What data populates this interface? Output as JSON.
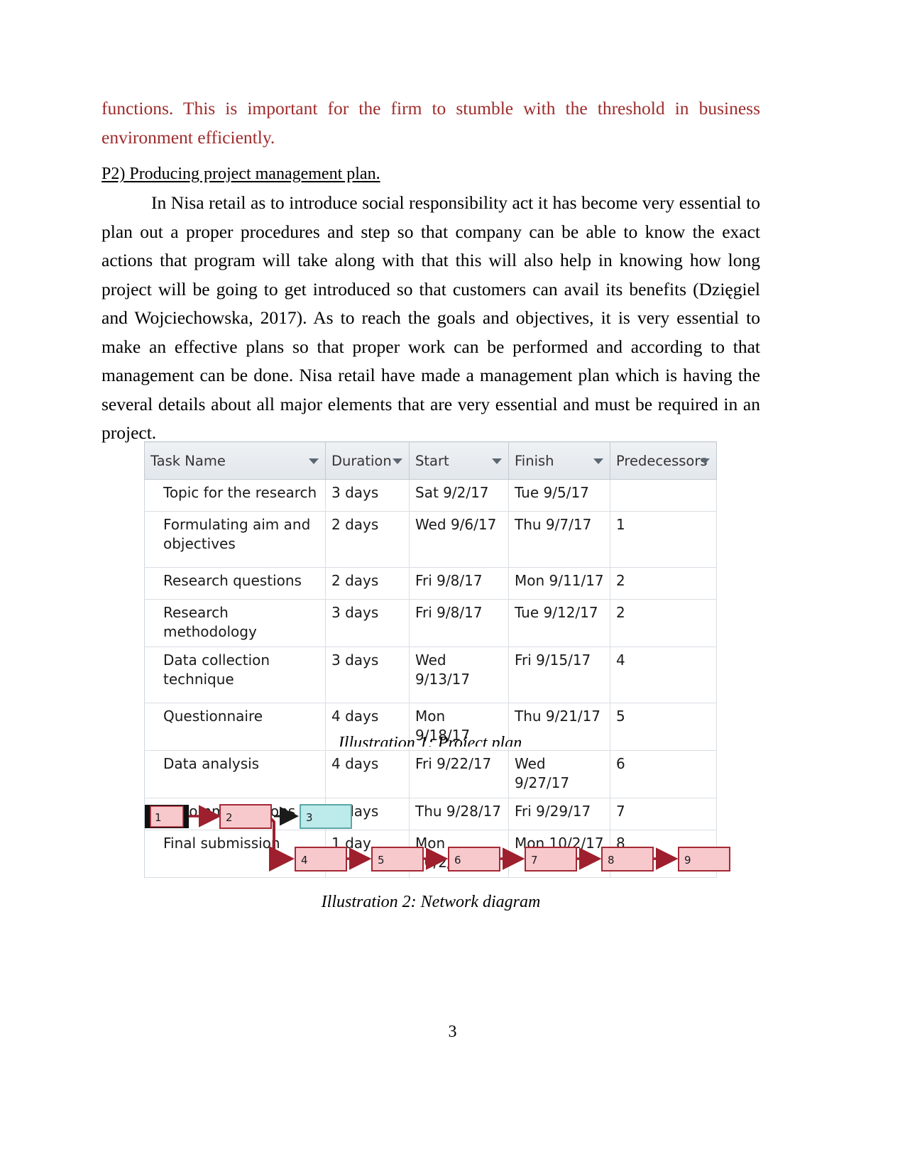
{
  "document": {
    "page_number": "3",
    "accent_red": "#9e2b2b",
    "paragraph_red": "functions. This is important for the firm to stumble with the threshold in business environment efficiently.",
    "heading": "P2) Producing project management plan.",
    "paragraph_body": "In Nisa retail as to introduce social responsibility act it has become very essential to plan out a proper procedures and step so that company can be able to know the exact actions that program will take along with that this will also help in knowing how long project will be going to get introduced so that customers can avail its benefits  (Dzięgiel and Wojciechowska, 2017). As to reach the goals and objectives, it is very essential to make an effective plans so that proper work can be performed and according to that management can be done. Nisa retail have made a management plan which is having the several details about all major elements that are very essential and must be required in an project."
  },
  "project_table": {
    "caption": "Illustration 1: Project plan",
    "columns": [
      {
        "label": "Task Name",
        "icon": "filter-dropdown-icon"
      },
      {
        "label": "Duration",
        "icon": "filter-dropdown-icon"
      },
      {
        "label": "Start",
        "icon": "filter-dropdown-icon"
      },
      {
        "label": "Finish",
        "icon": "filter-dropdown-icon"
      },
      {
        "label": "Predecessors",
        "icon": "filter-dropdown-icon"
      }
    ],
    "rows": [
      {
        "task": "Topic for the research",
        "duration": "3 days",
        "start": "Sat 9/2/17",
        "finish": "Tue 9/5/17",
        "predecessors": "",
        "tall": false,
        "selected": false
      },
      {
        "task": "Formulating aim and objectives",
        "duration": "2 days",
        "start": "Wed 9/6/17",
        "finish": "Thu 9/7/17",
        "predecessors": "1",
        "tall": true,
        "selected": false
      },
      {
        "task": "Research questions",
        "duration": "2 days",
        "start": "Fri 9/8/17",
        "finish": "Mon 9/11/17",
        "predecessors": "2",
        "tall": false,
        "selected": false
      },
      {
        "task": "Research methodology",
        "duration": "3 days",
        "start": "Fri 9/8/17",
        "finish": "Tue 9/12/17",
        "predecessors": "2",
        "tall": false,
        "selected": false
      },
      {
        "task": "Data collection technique",
        "duration": "3 days",
        "start": "Wed 9/13/17",
        "finish": "Fri 9/15/17",
        "predecessors": "4",
        "tall": true,
        "selected": false
      },
      {
        "task": "Questionnaire",
        "duration": "4 days",
        "start": "Mon 9/18/17",
        "finish": "Thu 9/21/17",
        "predecessors": "5",
        "tall": false,
        "selected": false
      },
      {
        "task": "Data analysis",
        "duration": "4 days",
        "start": "Fri 9/22/17",
        "finish": "Wed 9/27/17",
        "predecessors": "6",
        "tall": false,
        "selected": false
      },
      {
        "task": "Recommendations",
        "duration": "2 days",
        "start": "Thu 9/28/17",
        "finish": "Fri 9/29/17",
        "predecessors": "7",
        "tall": false,
        "selected": false
      },
      {
        "task": "Final submission",
        "duration": "1 day",
        "start": "Mon 10/2/17",
        "finish": "Mon 10/2/17",
        "predecessors": "8",
        "tall": false,
        "selected": true
      }
    ]
  },
  "network_diagram": {
    "caption": "Illustration 2: Network diagram",
    "colors": {
      "node_fill_pink": "#f7c9cd",
      "node_border_red": "#a52834",
      "node_fill_cyan": "#bdeaea",
      "node_border_cyan": "#5aa8a8",
      "selected_border": "#101010",
      "arrow": "#9e1f2d"
    },
    "nodes": [
      {
        "id": "1",
        "label": "1",
        "style": "pink-selected"
      },
      {
        "id": "2",
        "label": "2",
        "style": "pink"
      },
      {
        "id": "3",
        "label": "3",
        "style": "cyan"
      },
      {
        "id": "4",
        "label": "4",
        "style": "pink"
      },
      {
        "id": "5",
        "label": "5",
        "style": "pink"
      },
      {
        "id": "6",
        "label": "6",
        "style": "pink"
      },
      {
        "id": "7",
        "label": "7",
        "style": "pink"
      },
      {
        "id": "8",
        "label": "8",
        "style": "pink"
      },
      {
        "id": "9",
        "label": "9",
        "style": "pink"
      }
    ],
    "edges": [
      {
        "from": "1",
        "to": "2"
      },
      {
        "from": "2",
        "to": "3"
      },
      {
        "from": "2",
        "to": "4"
      },
      {
        "from": "4",
        "to": "5"
      },
      {
        "from": "5",
        "to": "6"
      },
      {
        "from": "6",
        "to": "7"
      },
      {
        "from": "7",
        "to": "8"
      },
      {
        "from": "8",
        "to": "9"
      }
    ]
  }
}
